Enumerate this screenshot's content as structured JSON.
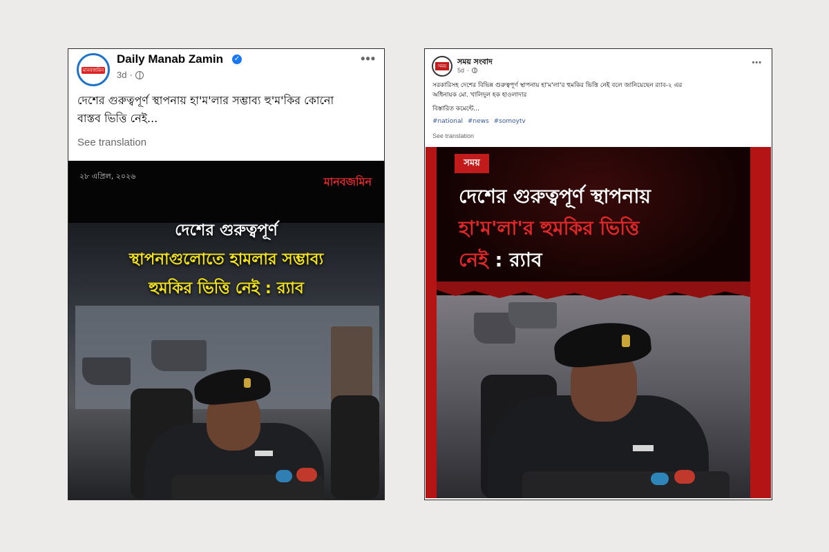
{
  "post1": {
    "page_name": "Daily Manab Zamin",
    "avatar_text": "মানবজমিন",
    "time": "3d",
    "caption_line1": "দেশের গুরুত্বপূর্ণ স্থাপনায় হা'ম'লার সম্ভাব্য হু'ম'কির কোনো",
    "caption_line2": "বাস্তব ভিত্তি নেই...",
    "see_translation": "See translation",
    "image": {
      "date": "২৮ এপ্রিল, ২০২৬",
      "logo": "মানবজমিন",
      "headline_white": "দেশের গুরুত্বপূর্ণ",
      "headline_yellow_1": "স্থাপনাগুলোতে হামলার সম্ভাব্য",
      "headline_yellow_2": "হুমকির ভিত্তি নেই : র‍্যাব",
      "accent_yellow": "#f2e21e",
      "accent_red": "#e02a2a"
    }
  },
  "post2": {
    "page_name": "সময় সংবাদ",
    "avatar_text": "সময়",
    "time": "5d",
    "caption_line1": "সরকারিসহ দেশের বিভিন্ন গুরুত্বপূর্ণ স্থাপনায় হা'ম'লা'র হুমকির ভিত্তি নেই বলে জানিয়েছেন র‍্যাব-২ এর",
    "caption_line2": "অধিনায়ক মো. খালিদুল হক হাওলাদার",
    "details": "বিস্তারিত কমেন্টে...",
    "hashtags": [
      "#national",
      "#news",
      "#somoytv"
    ],
    "see_translation": "See translation",
    "image": {
      "logo": "সময়",
      "headline_white_1": "দেশের গুরুত্বপূর্ণ স্থাপনায়",
      "headline_red": "হা'ম'লা'র হুমকির ভিত্তি",
      "headline_red_2": "নেই",
      "headline_white_2": ": র‍্যাব",
      "accent_red": "#e02828"
    }
  }
}
